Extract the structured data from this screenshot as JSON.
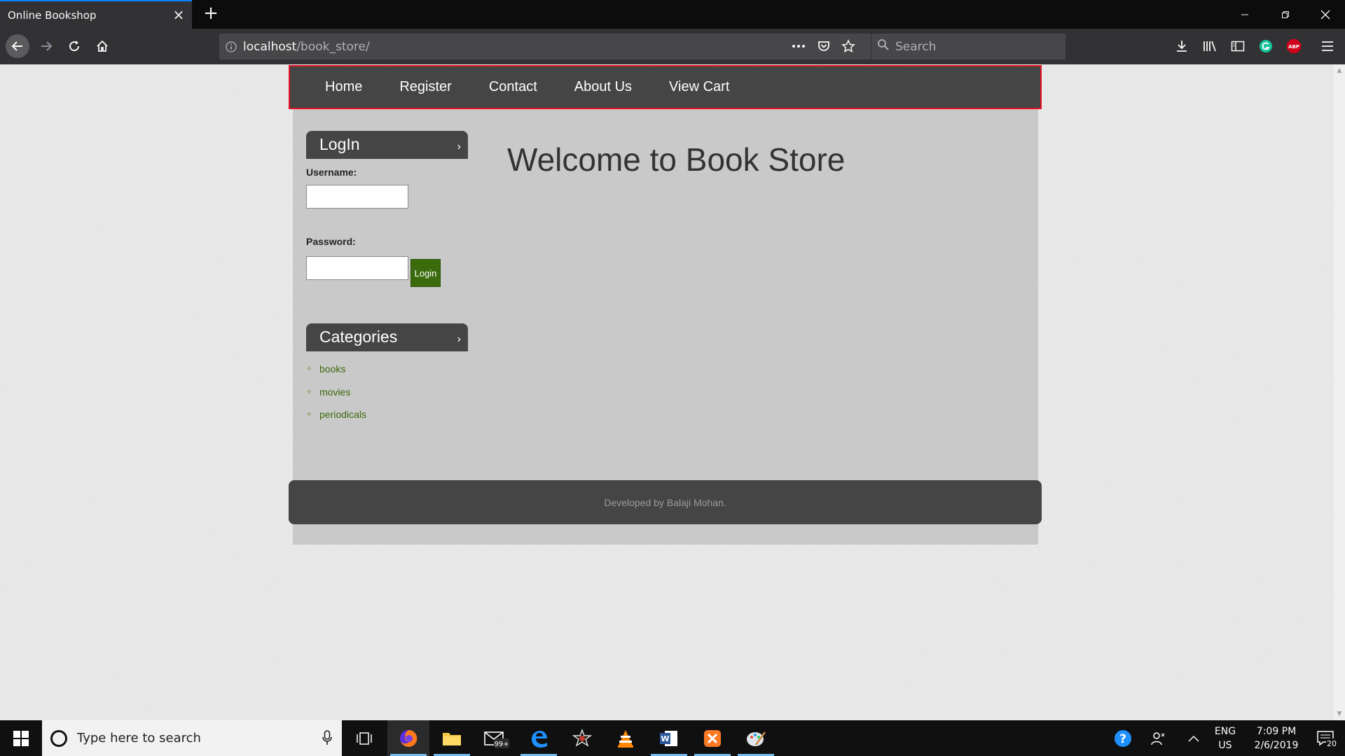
{
  "browser": {
    "tab_title": "Online Bookshop",
    "url_host": "localhost",
    "url_path": "/book_store/",
    "search_placeholder": "Search",
    "toolbar_icons": [
      "back-icon",
      "forward-icon",
      "reload-icon",
      "home-icon",
      "page-actions-icon",
      "pocket-icon",
      "bookmark-star-icon",
      "download-icon",
      "library-icon",
      "sidebar-icon",
      "grammarly-icon",
      "adblock-icon",
      "menu-icon"
    ]
  },
  "nav": {
    "items": [
      "Home",
      "Register",
      "Contact",
      "About Us",
      "View Cart"
    ]
  },
  "login": {
    "heading": "LogIn",
    "username_label": "Username:",
    "password_label": "Password:",
    "button_label": "Login"
  },
  "categories": {
    "heading": "Categories",
    "items": [
      "books",
      "movies",
      "periodicals"
    ]
  },
  "main": {
    "welcome": "Welcome to Book Store"
  },
  "footer": {
    "text": "Developed by Balaji Mohan."
  },
  "taskbar": {
    "search_placeholder": "Type here to search",
    "mail_badge": "99+",
    "lang_line1": "ENG",
    "lang_line2": "US",
    "time": "7:09 PM",
    "date": "2/6/2019",
    "notification_count": "20"
  },
  "colors": {
    "nav_bg": "#454545",
    "nav_outline": "#e81123",
    "content_bg": "#c9c9c9",
    "link_green": "#3b6a0c",
    "button_green": "#3c6b0e"
  }
}
